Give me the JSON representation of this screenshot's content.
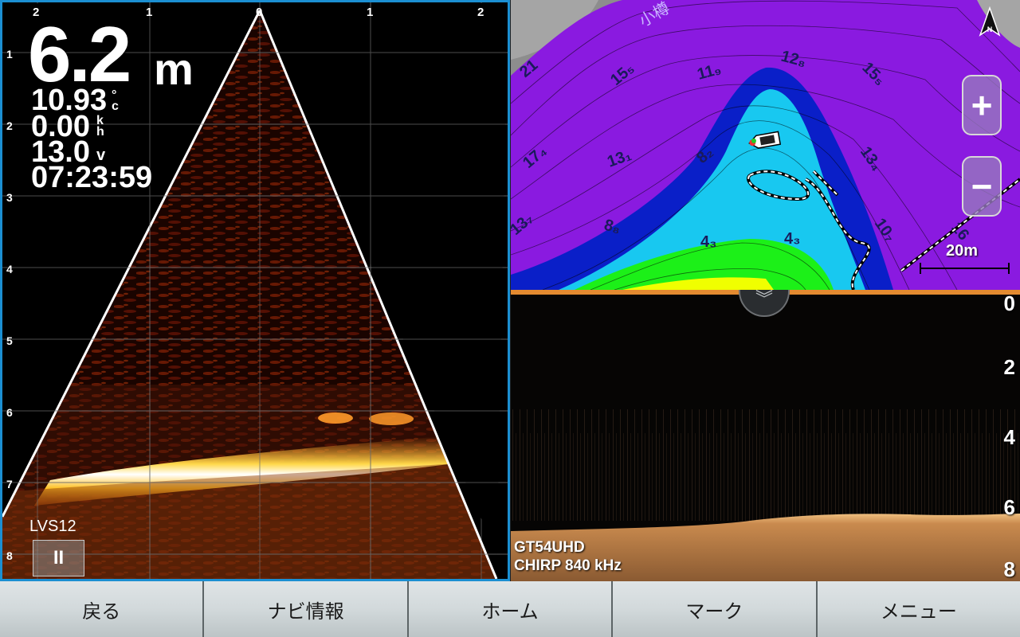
{
  "livescope": {
    "x_ticks": [
      "2",
      "1",
      "0",
      "1",
      "2"
    ],
    "y_ticks": [
      "1",
      "2",
      "3",
      "4",
      "5",
      "6",
      "7",
      "8"
    ],
    "depth_value": "6.2",
    "depth_unit": "m",
    "water_temp": "10.93",
    "temp_unit_top": "°",
    "temp_unit_bottom": "c",
    "speed": "0.00",
    "speed_unit_top": "k",
    "speed_unit_bottom": "h",
    "voltage": "13.0",
    "voltage_unit": "v",
    "time": "07:23:59",
    "transducer": "LVS12",
    "pause_label": "II"
  },
  "chart": {
    "scale_label": "20m",
    "zoom_in_label": "+",
    "zoom_out_label": "−",
    "place_label": "小樽",
    "contour_labels": [
      "21",
      "15₅",
      "12₈",
      "15₅",
      "11₉",
      "17₄",
      "13₁",
      "8₂",
      "13₄",
      "13₇",
      "8₈",
      "4₃",
      "4₃",
      "10₇",
      "16"
    ]
  },
  "sonar2d": {
    "depth_ticks": [
      "0",
      "2",
      "4",
      "6",
      "8"
    ],
    "transducer": "GT54UHD",
    "frequency": "CHIRP 840 kHz",
    "collapse_icon": "chevron-double-down-icon"
  },
  "nav": {
    "back": "戻る",
    "nav_info": "ナビ情報",
    "home": "ホーム",
    "mark": "マーク",
    "menu": "メニュー"
  },
  "colors": {
    "frame_accent": "#1b8fd2",
    "contour_purple": "#8a1ae0",
    "contour_blue": "#0a1fc8",
    "contour_cyan": "#18c8f0",
    "contour_green": "#1cf018",
    "contour_yellow": "#f0ff00"
  }
}
